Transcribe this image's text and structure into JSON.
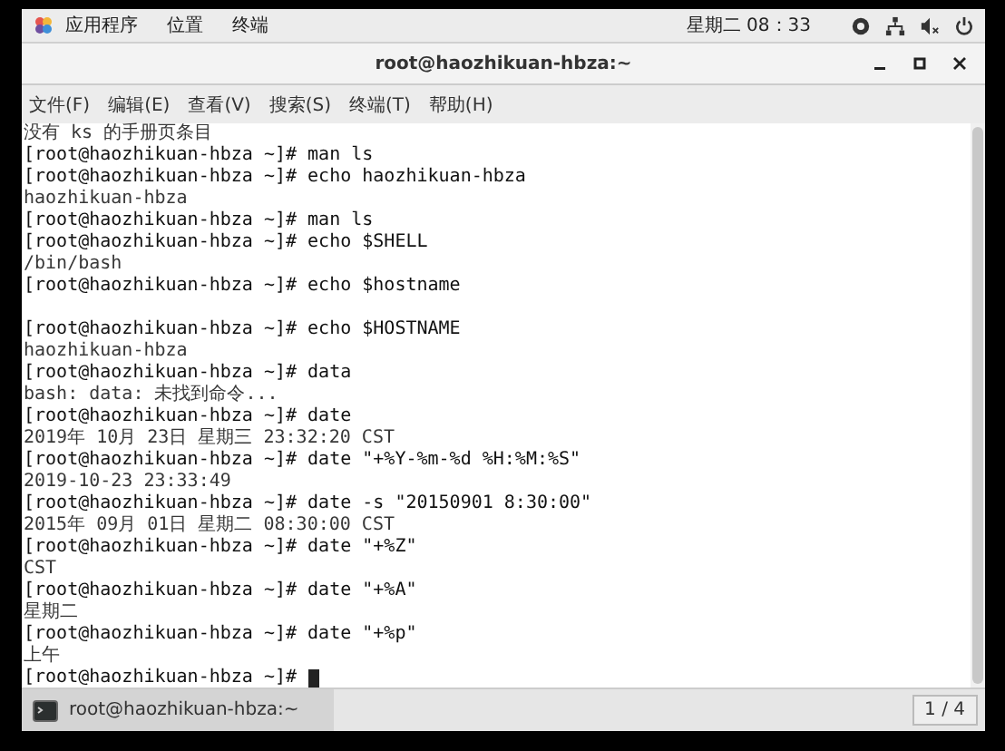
{
  "top_bar": {
    "menus": [
      "应用程序",
      "位置",
      "终端"
    ],
    "clock": "星期二 08：33"
  },
  "window": {
    "title": "root@haozhikuan-hbza:~"
  },
  "menu_bar": [
    "文件(F)",
    "编辑(E)",
    "查看(V)",
    "搜索(S)",
    "终端(T)",
    "帮助(H)"
  ],
  "terminal": {
    "lines": [
      {
        "kind": "output",
        "text": "没有 ks 的手册页条目"
      },
      {
        "kind": "prompt",
        "text": "[root@haozhikuan-hbza ~]# man ls"
      },
      {
        "kind": "prompt",
        "text": "[root@haozhikuan-hbza ~]# echo haozhikuan-hbza"
      },
      {
        "kind": "output",
        "text": "haozhikuan-hbza"
      },
      {
        "kind": "prompt",
        "text": "[root@haozhikuan-hbza ~]# man ls"
      },
      {
        "kind": "prompt",
        "text": "[root@haozhikuan-hbza ~]# echo $SHELL"
      },
      {
        "kind": "output",
        "text": "/bin/bash"
      },
      {
        "kind": "prompt",
        "text": "[root@haozhikuan-hbza ~]# echo $hostname"
      },
      {
        "kind": "blank"
      },
      {
        "kind": "prompt",
        "text": "[root@haozhikuan-hbza ~]# echo $HOSTNAME"
      },
      {
        "kind": "output",
        "text": "haozhikuan-hbza"
      },
      {
        "kind": "prompt",
        "text": "[root@haozhikuan-hbza ~]# data"
      },
      {
        "kind": "output",
        "text": "bash: data: 未找到命令..."
      },
      {
        "kind": "prompt",
        "text": "[root@haozhikuan-hbza ~]# date"
      },
      {
        "kind": "output",
        "text": "2019年 10月 23日 星期三 23:32:20 CST"
      },
      {
        "kind": "prompt",
        "text": "[root@haozhikuan-hbza ~]# date \"+%Y-%m-%d %H:%M:%S\""
      },
      {
        "kind": "output",
        "text": "2019-10-23 23:33:49"
      },
      {
        "kind": "prompt",
        "text": "[root@haozhikuan-hbza ~]# date -s \"20150901 8:30:00\""
      },
      {
        "kind": "output",
        "text": "2015年 09月 01日 星期二 08:30:00 CST"
      },
      {
        "kind": "prompt",
        "text": "[root@haozhikuan-hbza ~]# date \"+%Z\""
      },
      {
        "kind": "output",
        "text": "CST"
      },
      {
        "kind": "prompt",
        "text": "[root@haozhikuan-hbza ~]# date \"+%A\""
      },
      {
        "kind": "output",
        "text": "星期二"
      },
      {
        "kind": "prompt",
        "text": "[root@haozhikuan-hbza ~]# date \"+%p\""
      },
      {
        "kind": "output",
        "text": "上午"
      },
      {
        "kind": "cursor",
        "text": "[root@haozhikuan-hbza ~]#"
      }
    ]
  },
  "taskbar": {
    "items": [
      {
        "label": "root@haozhikuan-hbza:~",
        "selected": true
      }
    ],
    "workspace": "1 / 4"
  }
}
